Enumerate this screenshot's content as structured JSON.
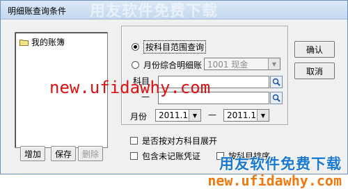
{
  "window": {
    "title": "明细账查询条件",
    "watermark_title": "用友软件免费下载"
  },
  "accounts": {
    "items": [
      {
        "label": "我的账簿"
      }
    ]
  },
  "left_buttons": {
    "add": "增加",
    "save": "保存",
    "delete": "删除"
  },
  "query": {
    "radio_range": "按科目范围查询",
    "radio_monthly": "月份综合明细账",
    "monthly_account_value": "1001 现金",
    "subject_label": "科目",
    "dash_label": "—",
    "month_label": "月份",
    "month_from": "2011.12",
    "month_to": "2011.12",
    "month_sep": "—"
  },
  "options": {
    "by_counter_account": "是否按对方科目展开",
    "include_unposted": "包含未记账凭证",
    "sort_by_account": "按科目排序"
  },
  "actions": {
    "ok": "确认",
    "cancel": "取消"
  },
  "watermarks": {
    "red_url": "new.ufidawhy.com",
    "brand_cn": "用友软件免费下载",
    "brand_url": "new.ufidawhy.com"
  },
  "colors": {
    "accent": "#1a78d0",
    "red": "#e01010",
    "orange": "#f07a10"
  }
}
